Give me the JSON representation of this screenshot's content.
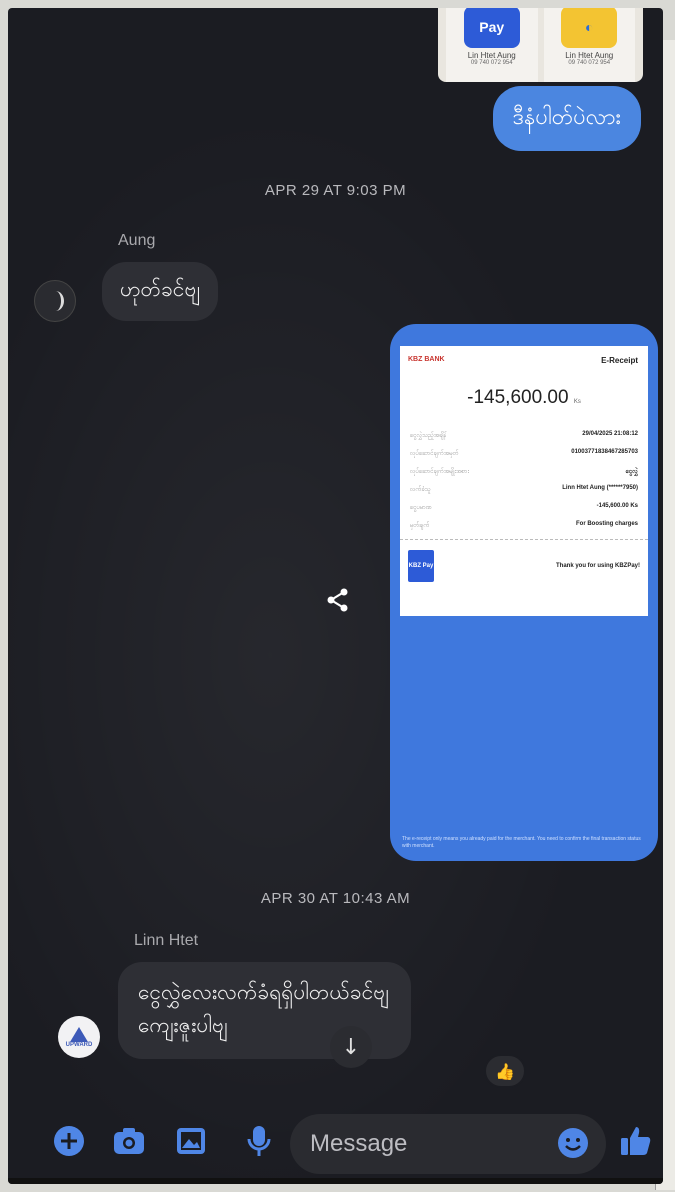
{
  "top_image": {
    "card1": {
      "logo": "Pay",
      "name": "Lin Htet Aung",
      "number": "09 740 072 954"
    },
    "card2": {
      "name": "Lin Htet Aung",
      "number": "09 740 072 954"
    }
  },
  "messages": {
    "outgoing_1": "ဒီနံပါတ်ပဲလား",
    "timestamp_1": "APR 29 AT 9:03 PM",
    "aung_sender": "Aung",
    "aung_msg": "ဟုတ်ခင်ဗျ",
    "timestamp_2": "APR 30 AT 10:43 AM",
    "linn_sender": "Linn Htet",
    "linn_msg_line1": "ငွေလွှဲလေးလက်ခံရရှိပါတယ်ခင်ဗျ",
    "linn_msg_line2": "ကျေးဇူးပါဗျ",
    "linn_avatar_text": "UPWARD",
    "reaction": "👍"
  },
  "receipt": {
    "bank": "KBZ BANK",
    "title": "E-Receipt",
    "amount": "-145,600.00",
    "currency": "Ks",
    "rows": [
      {
        "label": "ငွေလွှဲသည့်အချိန်",
        "value": "29/04/2025 21:08:12"
      },
      {
        "label": "လုပ်ဆောင်ချက်အမှတ်",
        "value": "01003771838467285703"
      },
      {
        "label": "လုပ်ဆောင်ချက်အမျိုးအစား",
        "value": "ငွေလွှဲ"
      },
      {
        "label": "လက်ခံသူ",
        "value": "Linn Htet Aung (******7950)"
      },
      {
        "label": "ငွေပမာဏ",
        "value": "-145,600.00 Ks"
      },
      {
        "label": "မှတ်ချက်",
        "value": "For Boosting charges"
      }
    ],
    "logo_text": "KBZ Pay",
    "thanks": "Thank you for using KBZPay!",
    "disclaimer": "The e-receipt only means you already paid for the merchant. You need to confirm the final transaction status with merchant."
  },
  "composer": {
    "placeholder": "Message"
  },
  "colors": {
    "outgoing_bubble": "#4b86e0",
    "incoming_bubble": "#2e2f35",
    "icon_blue": "#4f86e6"
  }
}
